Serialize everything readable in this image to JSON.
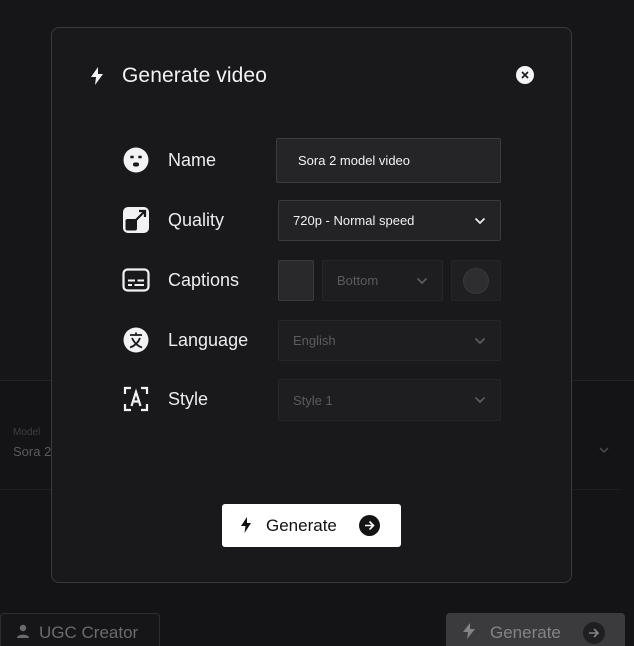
{
  "modal": {
    "title": "Generate video",
    "icon": "bolt-icon",
    "close_icon": "close-icon",
    "rows": {
      "name": {
        "label": "Name",
        "icon": "face-icon",
        "value": "Sora 2 model video"
      },
      "quality": {
        "label": "Quality",
        "icon": "expand-arrows-icon",
        "value": "720p - Normal speed"
      },
      "captions": {
        "label": "Captions",
        "icon": "subtitles-icon",
        "position": "Bottom"
      },
      "language": {
        "label": "Language",
        "icon": "translate-icon",
        "value": "English"
      },
      "style": {
        "label": "Style",
        "icon": "text-frame-icon",
        "value": "Style 1"
      }
    },
    "generate_label": "Generate"
  },
  "background": {
    "model_label": "Model",
    "model_value": "Sora 2",
    "ugc_label": "UGC Creator",
    "generate_label": "Generate"
  },
  "colors": {
    "page_bg": "#161618",
    "modal_bg": "#19191b",
    "accent_button": "#ffffff",
    "field_bg": "#232325"
  }
}
